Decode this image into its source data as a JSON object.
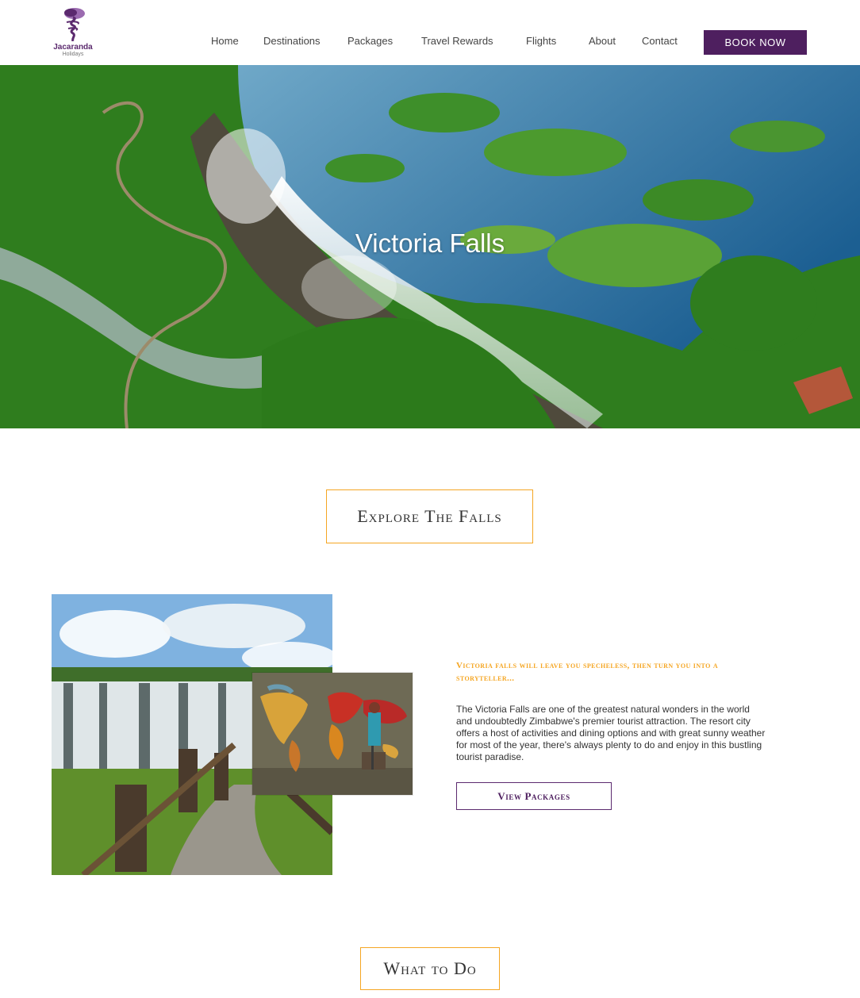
{
  "brand": {
    "name": "Jacaranda",
    "sub": "Holidays",
    "logo_icon": "jacaranda-tree-logo",
    "color": "#5b2a6e"
  },
  "nav": {
    "items": [
      {
        "label": "Home"
      },
      {
        "label": "Destinations"
      },
      {
        "label": "Packages"
      },
      {
        "label": "Travel Rewards"
      },
      {
        "label": "Flights"
      },
      {
        "label": "About"
      },
      {
        "label": "Contact"
      }
    ],
    "book_label": "BOOK NOW"
  },
  "hero": {
    "title": "Victoria Falls"
  },
  "explore": {
    "title": "Explore The Falls",
    "tagline": "Victoria Falls will leave you specheless, then turn you into a storyteller...",
    "body": "The Victoria Falls are one of the greatest natural wonders in the world and undoubtedly Zimbabwe's premier tourist attraction. The resort city offers a host of activities and dining options and with great sunny weather for most of the year, there's always plenty to do and enjoy in this bustling tourist paradise.",
    "button_label": "View Packages"
  },
  "what_to_do": {
    "title": "What to Do"
  },
  "colors": {
    "accent": "#f5a623",
    "brand_purple": "#4e1f5f"
  }
}
